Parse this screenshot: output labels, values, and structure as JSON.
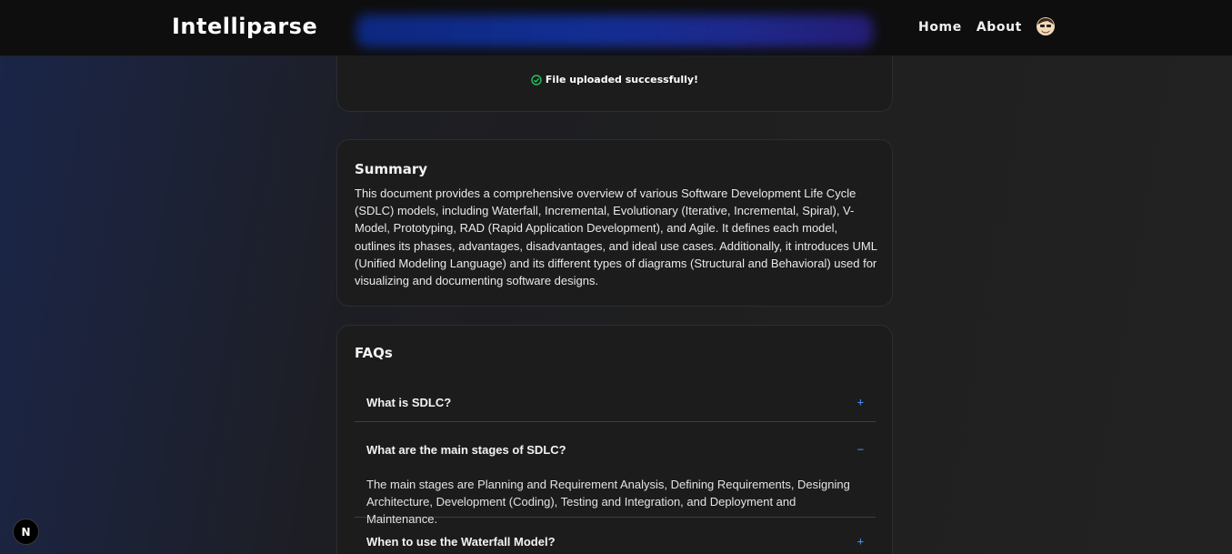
{
  "navbar": {
    "brand": "Intelliparse",
    "links": [
      "Home",
      "About"
    ],
    "avatar_icon": "user-avatar-icon"
  },
  "upload": {
    "status_text": "File uploaded successfully!",
    "status_color": "#22c55e"
  },
  "summary": {
    "title": "Summary",
    "text": "This document provides a comprehensive overview of various Software Development Life Cycle (SDLC) models, including Waterfall, Incremental, Evolutionary (Iterative, Incremental, Spiral), V-Model, Prototyping, RAD (Rapid Application Development), and Agile. It defines each model, outlines its phases, advantages, disadvantages, and ideal use cases. Additionally, it introduces UML (Unified Modeling Language) and its different types of diagrams (Structural and Behavioral) used for visualizing and documenting software designs."
  },
  "faqs": {
    "title": "FAQs",
    "accent_color": "#4f8df5",
    "items": [
      {
        "question": "What is SDLC?",
        "toggle": "+",
        "expanded": false
      },
      {
        "question": "What are the main stages of SDLC?",
        "toggle": "−",
        "expanded": true,
        "answer": "The main stages are Planning and Requirement Analysis, Defining Requirements, Designing Architecture, Development (Coding), Testing and Integration, and Deployment and Maintenance."
      },
      {
        "question": "When to use the Waterfall Model?",
        "toggle": "+",
        "expanded": false
      }
    ]
  },
  "dev_badge": {
    "label": "N"
  }
}
